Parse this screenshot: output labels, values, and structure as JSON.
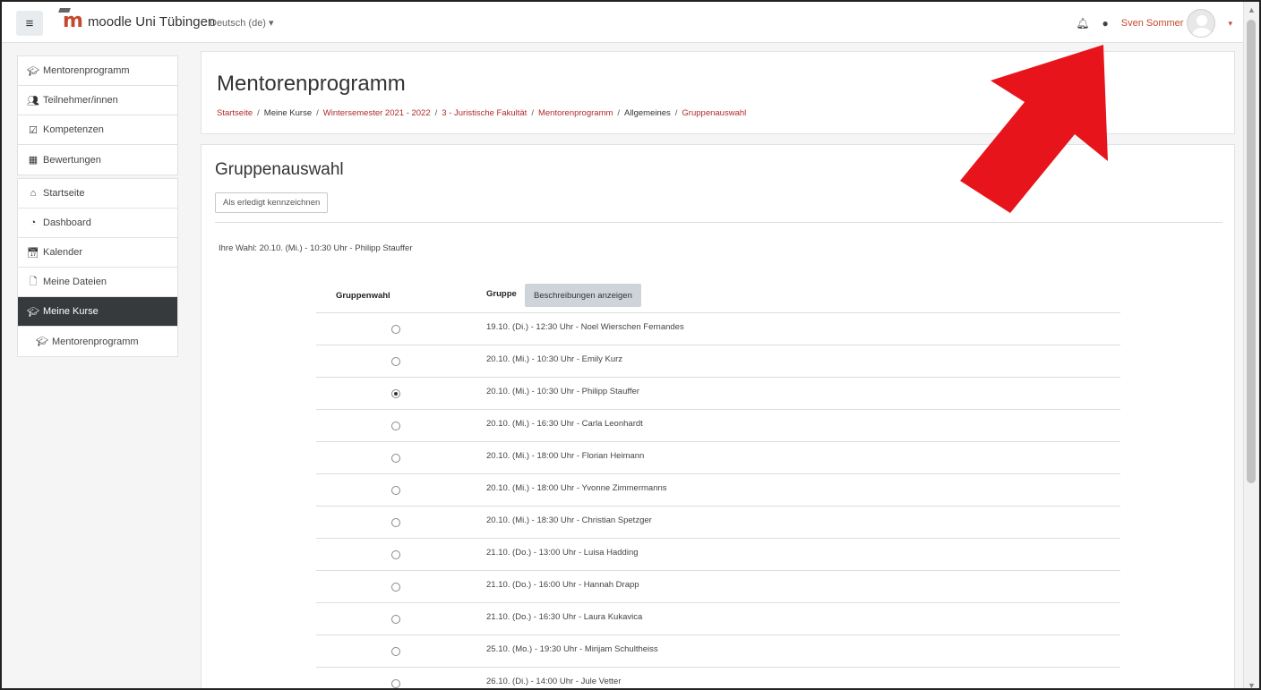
{
  "navbar": {
    "menu_icon": "hamburger-icon",
    "brand_text": "moodle Uni Tübingen",
    "brand_logo": "m",
    "language": "Deutsch (de)",
    "language_caret": "▾",
    "notification_icon": "bell-icon",
    "messages_icon": "speech-bubble-icon",
    "username": "Sven Sommer",
    "user_caret": "▾"
  },
  "sidebar": {
    "groups": [
      [
        {
          "label": "Mentorenprogramm",
          "icon": "graduation-cap-icon"
        },
        {
          "label": "Teilnehmer/innen",
          "icon": "users-icon"
        },
        {
          "label": "Kompetenzen",
          "icon": "checkbox-icon"
        },
        {
          "label": "Bewertungen",
          "icon": "table-icon"
        }
      ],
      [
        {
          "label": "Startseite",
          "icon": "home-icon"
        },
        {
          "label": "Dashboard",
          "icon": "dashboard-icon"
        },
        {
          "label": "Kalender",
          "icon": "calendar-icon"
        },
        {
          "label": "Meine Dateien",
          "icon": "file-icon"
        },
        {
          "label": "Meine Kurse",
          "icon": "graduation-cap-icon",
          "active": true
        },
        {
          "label": "Mentorenprogramm",
          "icon": "graduation-cap-icon",
          "indent": true
        }
      ]
    ]
  },
  "header": {
    "title": "Mentorenprogramm",
    "breadcrumb": [
      {
        "label": "Startseite",
        "link": true
      },
      {
        "label": "Meine Kurse",
        "link": false
      },
      {
        "label": "Wintersemester 2021 - 2022",
        "link": true
      },
      {
        "label": "3 - Juristische Fakultät",
        "link": true
      },
      {
        "label": "Mentorenprogramm",
        "link": true
      },
      {
        "label": "Allgemeines",
        "link": false
      },
      {
        "label": "Gruppenauswahl",
        "link": true
      }
    ]
  },
  "main": {
    "title": "Gruppenauswahl",
    "done_button": "Als erledigt kennzeichnen",
    "current_choice": "Ihre Wahl: 20.10. (Mi.) - 10:30 Uhr - Philipp Stauffer",
    "col_choice": "Gruppenwahl",
    "col_group": "Gruppe",
    "desc_button": "Beschreibungen anzeigen",
    "groups": [
      {
        "label": "19.10. (Di.) - 12:30 Uhr - Noel Wierschen Fernandes",
        "selected": false
      },
      {
        "label": "20.10. (Mi.) - 10:30 Uhr - Emily Kurz",
        "selected": false
      },
      {
        "label": "20.10. (Mi.) - 10:30 Uhr - Philipp Stauffer",
        "selected": true
      },
      {
        "label": "20.10. (Mi.) - 16:30 Uhr - Carla Leonhardt",
        "selected": false
      },
      {
        "label": "20.10. (Mi.) - 18:00 Uhr - Florian Heimann",
        "selected": false
      },
      {
        "label": "20.10. (Mi.) - 18:00 Uhr - Yvonne Zimmermanns",
        "selected": false
      },
      {
        "label": "20.10. (Mi.) - 18:30 Uhr - Christian Spetzger",
        "selected": false
      },
      {
        "label": "21.10. (Do.) - 13:00 Uhr - Luisa Hadding",
        "selected": false
      },
      {
        "label": "21.10. (Do.) - 16:00 Uhr - Hannah Drapp",
        "selected": false
      },
      {
        "label": "21.10. (Do.) - 16:30 Uhr - Laura Kukavica",
        "selected": false
      },
      {
        "label": "25.10. (Mo.) - 19:30 Uhr - Mirijam Schultheiss",
        "selected": false
      },
      {
        "label": "26.10. (Di.) - 14:00 Uhr - Jule Vetter",
        "selected": false
      }
    ]
  },
  "colors": {
    "brand": "#c34a2c",
    "link": "#b02a2a",
    "active_sidebar": "#373a3c",
    "annotation_arrow": "#e8141c"
  }
}
